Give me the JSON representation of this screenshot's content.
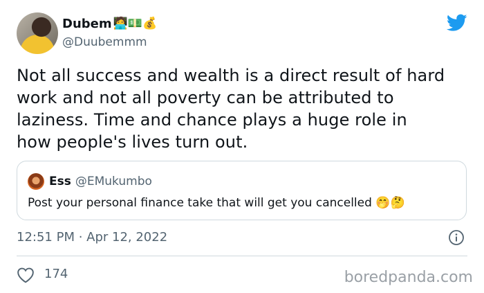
{
  "tweet": {
    "author_name": "Dubem",
    "author_emojis": "🧑‍💻💵💰",
    "author_handle": "@Duubemmm",
    "text": "Not all success and wealth is a direct result of hard\nwork and not all poverty can be attributed to\nlaziness. Time and chance plays a huge role in\nhow people's lives turn out.",
    "timestamp": "12:51 PM · Apr 12, 2022",
    "likes": "174"
  },
  "quoted_tweet": {
    "author_name": "Ess",
    "author_handle": "@EMukumbo",
    "text": "Post your personal finance take that will get you cancelled",
    "emojis": "🤭🤔"
  },
  "watermark": "boredpanda.com",
  "colors": {
    "twitter_blue": "#1d9bf0",
    "secondary_text": "#536471",
    "border": "#cfd9de"
  },
  "icons": [
    "twitter-logo-icon",
    "info-icon",
    "heart-icon"
  ]
}
